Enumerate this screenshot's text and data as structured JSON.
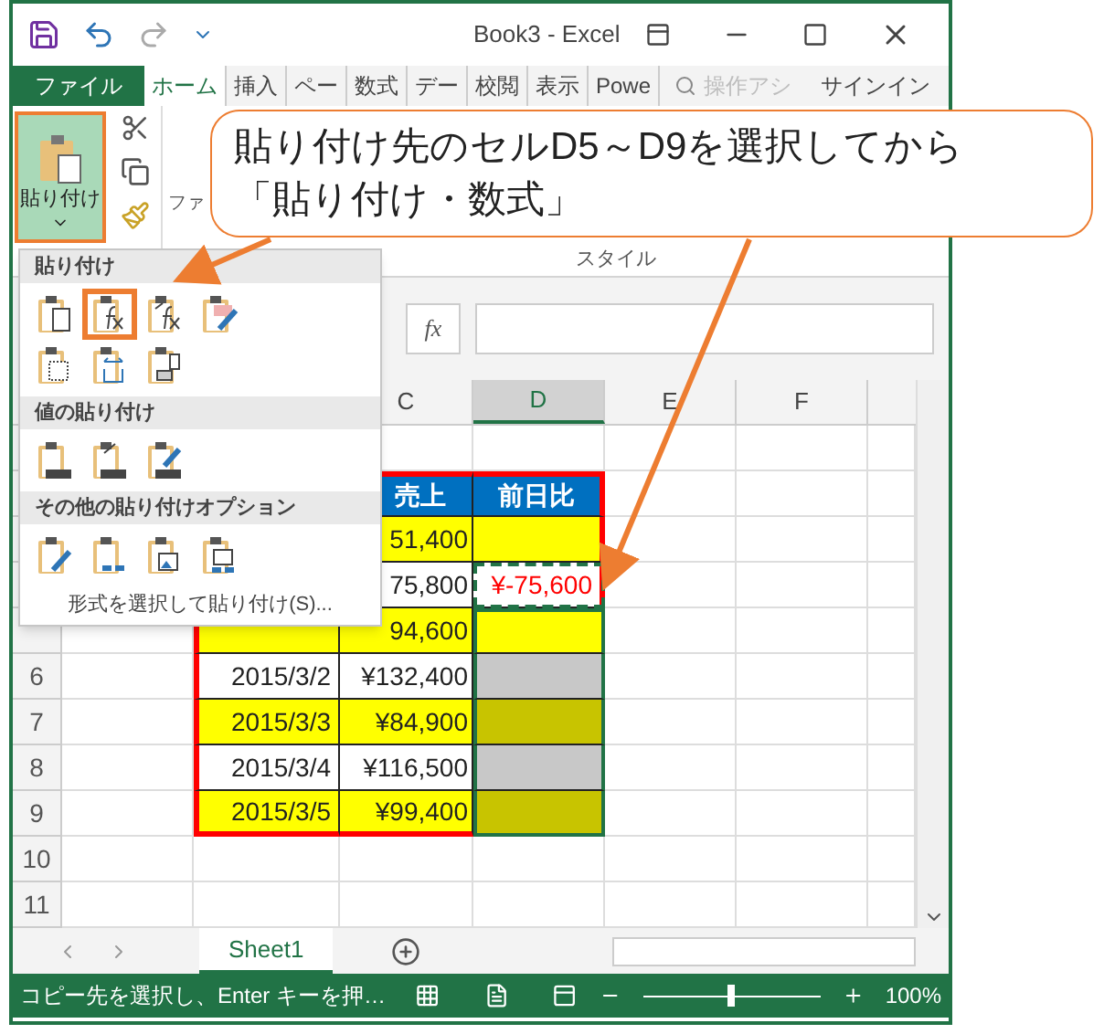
{
  "window": {
    "title": "Book3 - Excel"
  },
  "tabs": [
    {
      "label": "ファイル",
      "kind": "file",
      "selected": false
    },
    {
      "label": "ホーム",
      "kind": "tab",
      "selected": true
    },
    {
      "label": "挿入",
      "kind": "tab",
      "selected": false
    },
    {
      "label": "ペー",
      "kind": "tab",
      "selected": false
    },
    {
      "label": "数式",
      "kind": "tab",
      "selected": false
    },
    {
      "label": "デー",
      "kind": "tab",
      "selected": false
    },
    {
      "label": "校閲",
      "kind": "tab",
      "selected": false
    },
    {
      "label": "表示",
      "kind": "tab",
      "selected": false
    },
    {
      "label": "Powe",
      "kind": "tab",
      "selected": false
    }
  ],
  "tell_me": {
    "placeholder": "操作アシ"
  },
  "sign_in": "サインイン",
  "ribbon": {
    "paste_label": "貼り付け",
    "font_group": "ファ",
    "style_group": "スタイル"
  },
  "formula_bar": {
    "fx": "fx"
  },
  "columns": [
    {
      "label": "C",
      "selected": false
    },
    {
      "label": "D",
      "selected": true
    },
    {
      "label": "E",
      "selected": false
    },
    {
      "label": "F",
      "selected": false
    }
  ],
  "rows": [
    {
      "kind": "empty"
    },
    {
      "kind": "header",
      "sales": "売上",
      "change": "前日比"
    },
    {
      "kind": "shaded",
      "sales": "51,400",
      "d": {
        "selected": false,
        "active": false,
        "copied": false
      }
    },
    {
      "kind": "plain",
      "sales": "75,800",
      "d": {
        "text": "¥-75,600",
        "selected": false,
        "active": false,
        "copied": true
      }
    },
    {
      "kind": "shaded",
      "sales": "94,600",
      "d": {
        "selected": true,
        "active": true,
        "copied": false
      }
    },
    {
      "number": "6",
      "kind": "plain",
      "date": "2015/3/2",
      "sales": "¥132,400",
      "d": {
        "selected": true,
        "active": false,
        "copied": false
      }
    },
    {
      "number": "7",
      "kind": "shaded",
      "date": "2015/3/3",
      "sales": "¥84,900",
      "d": {
        "selected": true,
        "active": false,
        "copied": false
      }
    },
    {
      "number": "8",
      "kind": "plain",
      "date": "2015/3/4",
      "sales": "¥116,500",
      "d": {
        "selected": true,
        "active": false,
        "copied": false
      }
    },
    {
      "number": "9",
      "kind": "shaded",
      "date": "2015/3/5",
      "sales": "¥99,400",
      "d": {
        "selected": true,
        "active": false,
        "copied": false
      }
    },
    {
      "number": "10",
      "kind": "empty"
    },
    {
      "number": "11",
      "kind": "empty"
    }
  ],
  "sheet_tabs": [
    {
      "label": "Sheet1",
      "selected": true
    }
  ],
  "status_bar": {
    "message": "コピー先を選択し、Enter キーを押…",
    "zoom": "100%",
    "level": 0.5
  },
  "paste_menu": {
    "sections": [
      {
        "title": "貼り付け",
        "options": [
          {
            "kind": "paste",
            "selected": false
          },
          {
            "kind": "formula",
            "selected": true
          },
          {
            "kind": "formulanum",
            "selected": false
          },
          {
            "kind": "source",
            "selected": false
          },
          {
            "kind": "noborder",
            "selected": false
          },
          {
            "kind": "widths",
            "selected": false
          },
          {
            "kind": "transpose",
            "selected": false
          }
        ]
      },
      {
        "title": "値の貼り付け",
        "options": [
          {
            "kind": "values",
            "selected": false
          },
          {
            "kind": "valuesnum",
            "selected": false
          },
          {
            "kind": "valuessource",
            "selected": false
          }
        ]
      },
      {
        "title": "その他の貼り付けオプション",
        "options": [
          {
            "kind": "format",
            "selected": false
          },
          {
            "kind": "link",
            "selected": false
          },
          {
            "kind": "picture",
            "selected": false
          },
          {
            "kind": "linkedpicture",
            "selected": false
          }
        ]
      }
    ],
    "special": "形式を選択して貼り付け(S)..."
  },
  "callout": {
    "lines": [
      "貼り付け先のセルD5～D9を選択してから",
      "「貼り付け・数式」"
    ]
  }
}
